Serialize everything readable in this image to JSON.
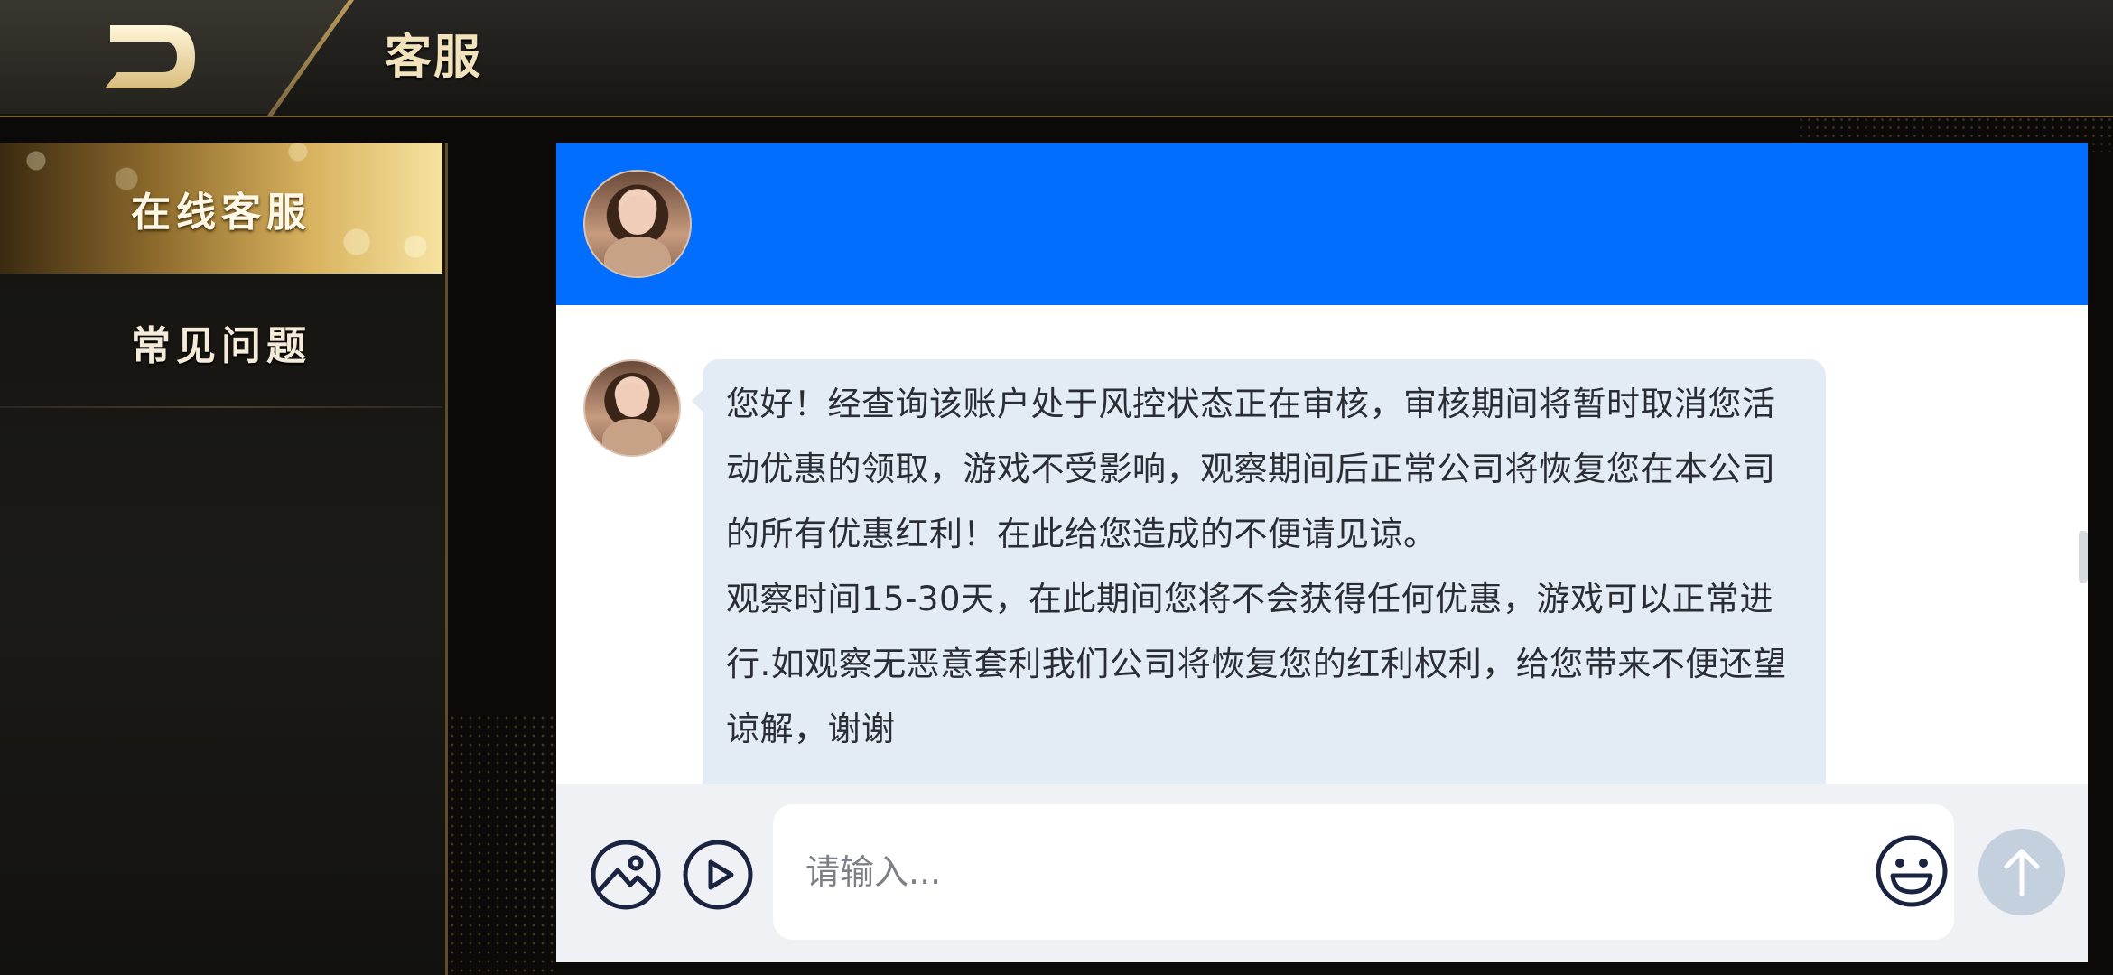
{
  "header": {
    "title": "客服",
    "back_icon": "back-arrow-icon"
  },
  "sidebar": {
    "items": [
      {
        "label": "在线客服",
        "active": true
      },
      {
        "label": "常见问题",
        "active": false
      }
    ]
  },
  "chat": {
    "header_color": "#016eff",
    "messages": [
      {
        "from": "agent",
        "paragraphs": [
          "您好！经查询该账户处于风控状态正在审核，审核期间将暂时取消您活动优惠的领取，游戏不受影响，观察期间后正常公司将恢复您在本公司的所有优惠红利！在此给您造成的不便请见谅。",
          "观察时间15-30天，在此期间您将不会获得任何优惠，游戏可以正常进行.如观察无恶意套利我们公司将恢复您的红利权利，给您带来不便还望谅解，谢谢"
        ]
      }
    ]
  },
  "input": {
    "placeholder": "请输入...",
    "value": "",
    "icons": [
      "image-icon",
      "play-icon",
      "emoji-icon",
      "send-arrow-icon"
    ]
  },
  "colors": {
    "accent_gold": "#d8b25e",
    "chat_blue": "#016eff",
    "bubble_bg": "#e3ebf4",
    "send_disabled": "#c4d0de"
  }
}
